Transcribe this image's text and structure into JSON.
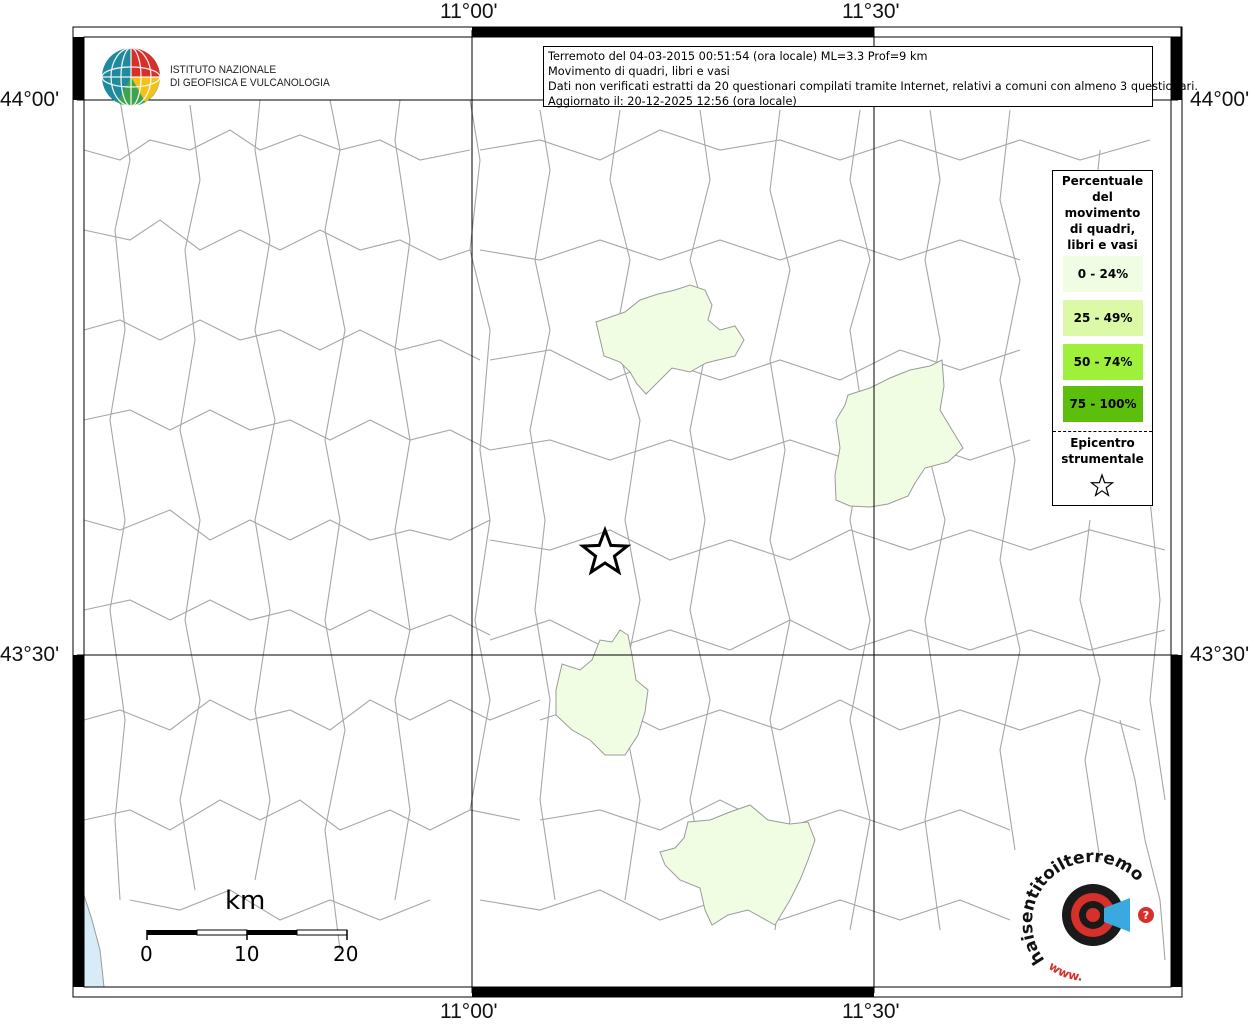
{
  "info": {
    "line1": "Terremoto del 04-03-2015 00:51:54 (ora locale) ML=3.3 Prof=9 km",
    "line2": "Movimento di quadri, libri e vasi",
    "line3": "Dati non verificati estratti da 20 questionari compilati tramite Internet, relativi a comuni con almeno 3 questionari.",
    "line4": "Aggiornato il: 20-12-2025 12:56 (ora locale)"
  },
  "coords": {
    "lon_a": "11°00'",
    "lon_b": "11°30'",
    "lat_a": "44°00'",
    "lat_b": "43°30'"
  },
  "logo": {
    "line1": "ISTITUTO NAZIONALE",
    "line2": "DI GEOFISICA E VULCANOLOGIA"
  },
  "legend": {
    "title_lines": [
      "Percentuale",
      "del",
      "movimento",
      "di quadri,",
      "libri e vasi"
    ],
    "classes": [
      {
        "label": "0 - 24%",
        "color": "#f1fde2"
      },
      {
        "label": "25 - 49%",
        "color": "#dcf9a8"
      },
      {
        "label": "50 - 74%",
        "color": "#9ff03a"
      },
      {
        "label": "75 - 100%",
        "color": "#5bbf0c"
      }
    ],
    "epicenter_line1": "Epicentro",
    "epicenter_line2": "strumentale",
    "star_icon": "star-outline-icon"
  },
  "scale": {
    "unit": "km",
    "tick0": "0",
    "tick1": "10",
    "tick2": "20"
  },
  "brand": {
    "name": "haisentitoilterremoto.it",
    "prefix": "www."
  },
  "colors": {
    "fill_low": "#f1fde2",
    "boundary": "#9a9a9a",
    "sea": "#d8ecf7",
    "frame": "#000000"
  }
}
